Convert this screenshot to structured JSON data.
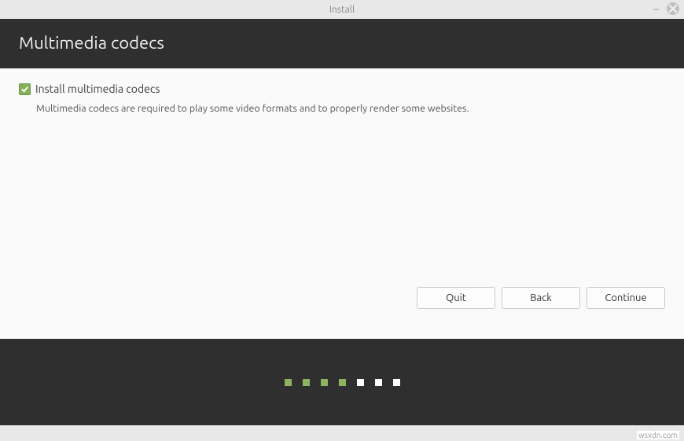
{
  "window": {
    "title": "Install"
  },
  "header": {
    "title": "Multimedia codecs"
  },
  "main": {
    "checkbox_label": "Install multimedia codecs",
    "checkbox_checked": true,
    "description": "Multimedia codecs are required to play some video formats and to properly render some websites."
  },
  "buttons": {
    "quit": "Quit",
    "back": "Back",
    "continue": "Continue"
  },
  "progress": {
    "total": 7,
    "completed": 4,
    "current": 5
  },
  "watermark": "wsxdn.com",
  "colors": {
    "accent": "#87b158",
    "header_bg": "#2f2f2f",
    "content_bg": "#fafafa"
  }
}
